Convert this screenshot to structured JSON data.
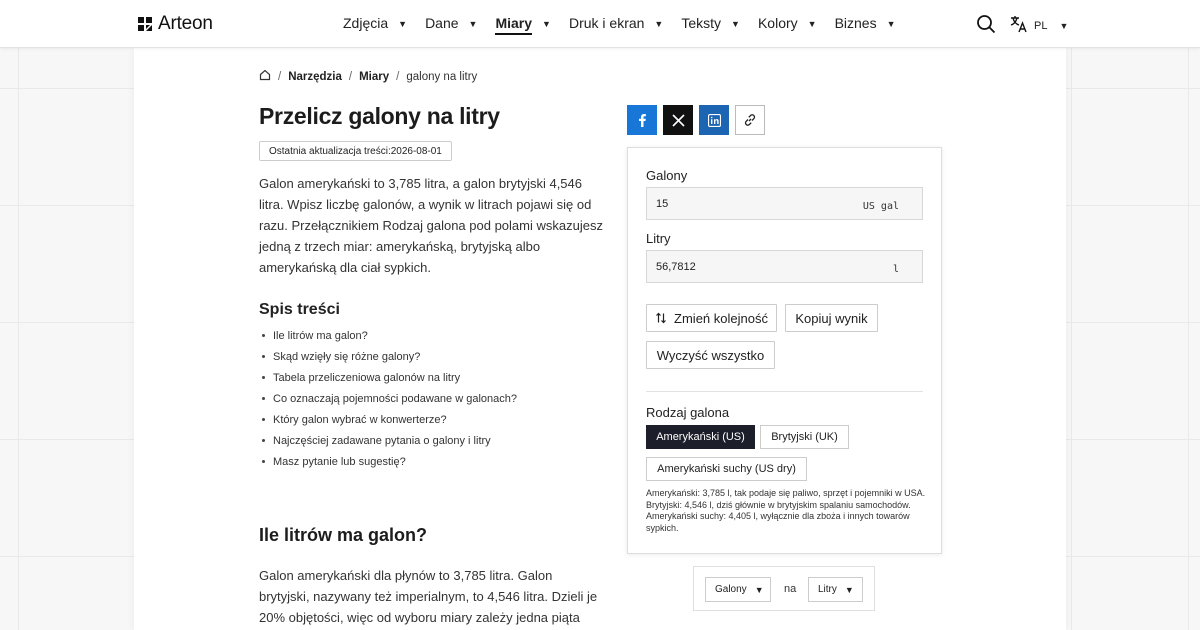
{
  "header": {
    "logo_text": "Arteon",
    "nav": [
      {
        "label": "Zdjęcia"
      },
      {
        "label": "Dane"
      },
      {
        "label": "Miary"
      },
      {
        "label": "Druk i ekran"
      },
      {
        "label": "Teksty"
      },
      {
        "label": "Kolory"
      },
      {
        "label": "Biznes"
      }
    ],
    "active_nav": "Miary",
    "lang": "PL"
  },
  "breadcrumb": {
    "items": [
      "Narzędzia",
      "Miary",
      "galony na litry"
    ]
  },
  "article": {
    "title": "Przelicz galony na litry",
    "updated_label": "Ostatnia aktualizacja treści:2026-08-01",
    "intro": "Galon amerykański to 3,785 litra, a galon brytyjski 4,546 litra. Wpisz liczbę galonów, a wynik w litrach pojawi się od razu. Przełącznikiem Rodzaj galona pod polami wskazujesz jedną z trzech miar: amerykańską, brytyjską albo amerykańską dla ciał sypkich.",
    "toc_title": "Spis treści",
    "toc": [
      "Ile litrów ma galon?",
      "Skąd wzięły się różne galony?",
      "Tabela przeliczeniowa galonów na litry",
      "Co oznaczają pojemności podawane w galonach?",
      "Który galon wybrać w konwerterze?",
      "Najczęściej zadawane pytania o galony i litry",
      "Masz pytanie lub sugestię?"
    ],
    "section_title": "Ile litrów ma galon?",
    "section_body": "Galon amerykański dla płynów to 3,785 litra. Galon brytyjski, nazywany też imperialnym, to 4,546 litra. Dzieli je 20% objętości, więc od wyboru miary zależy jedna piąta"
  },
  "converter": {
    "from_label": "Galony",
    "from_value": "15",
    "from_unit": "US gal",
    "to_label": "Litry",
    "to_value": "56,7812",
    "to_unit": "l",
    "swap_label": "Zmień kolejność",
    "copy_label": "Kopiuj wynik",
    "clear_label": "Wyczyść wszystko",
    "gallon_type_label": "Rodzaj galona",
    "gallon_types": [
      "Amerykański (US)",
      "Brytyjski (UK)",
      "Amerykański suchy (US dry)"
    ],
    "selected_type": "Amerykański (US)",
    "note": "Amerykański: 3,785 l, tak podaje się paliwo, sprzęt i pojemniki w USA. Brytyjski: 4,546 l, dziś głównie w brytyjskim spalaniu samochodów. Amerykański suchy: 4,405 l, wyłącznie dla zboża i innych towarów sypkich."
  },
  "unit_pair": {
    "from": "Galony",
    "separator": "na",
    "to": "Litry"
  },
  "colors": {
    "facebook": "#1877d6",
    "x": "#111111",
    "linkedin": "#1b65b2",
    "selected_option": "#1c1f2a"
  }
}
